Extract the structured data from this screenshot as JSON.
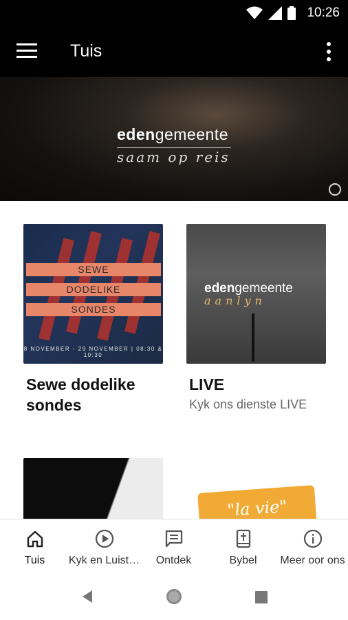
{
  "status_bar": {
    "time": "10:26",
    "icons": [
      "wifi-icon",
      "signal-icon",
      "battery-icon"
    ]
  },
  "app_bar": {
    "title": "Tuis",
    "menu_icon": "menu-icon",
    "more_icon": "more-vert-icon"
  },
  "hero": {
    "brand_bold": "eden",
    "brand_regular": "gemeente",
    "tagline": "saam op reis"
  },
  "cards": [
    {
      "title": "Sewe dodelike sondes",
      "subtitle": "",
      "thumb": {
        "bands": [
          "SEWE",
          "DODELIKE",
          "SONDES"
        ],
        "dates": "8 NOVEMBER - 29 NOVEMBER | 08:30 & 10:30"
      }
    },
    {
      "title": "LIVE",
      "subtitle": "Kyk ons dienste LIVE",
      "thumb": {
        "brand_bold": "eden",
        "brand_regular": "gemeente",
        "sub": "aanlyn"
      }
    },
    {
      "title": "",
      "subtitle": ""
    },
    {
      "title": "",
      "subtitle": "",
      "thumb": {
        "text": "\"la vie\""
      }
    }
  ],
  "bottom_nav": [
    {
      "label": "Tuis",
      "icon": "home-icon",
      "active": true
    },
    {
      "label": "Kyk en Luist…",
      "icon": "play-circle-icon",
      "active": false
    },
    {
      "label": "Ontdek",
      "icon": "comment-icon",
      "active": false
    },
    {
      "label": "Bybel",
      "icon": "bible-icon",
      "active": false
    },
    {
      "label": "Meer oor ons",
      "icon": "info-icon",
      "active": false
    }
  ],
  "system_nav": [
    "back-icon",
    "home-button-icon",
    "recents-icon"
  ]
}
